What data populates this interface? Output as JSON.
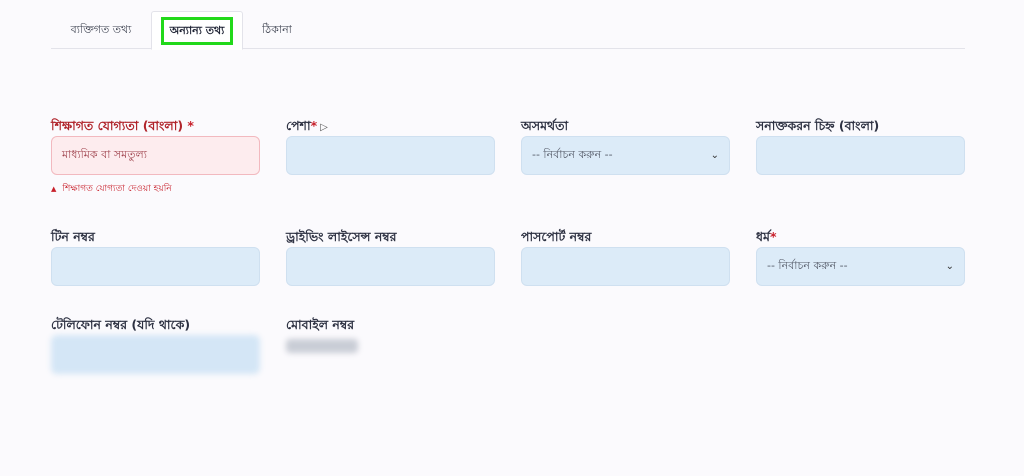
{
  "tabs": [
    {
      "label": "ব্যক্তিগত তথ্য"
    },
    {
      "label": "অন্যান্য তথ্য"
    },
    {
      "label": "ঠিকানা"
    }
  ],
  "fields": {
    "education": {
      "label": "শিক্ষাগত যোগ্যতা (বাংলা)",
      "required": "*",
      "value": "মাধ্যমিক বা সমতুল্য",
      "error": "শিক্ষাগত যোগ্যতা দেওয়া হয়নি"
    },
    "occupation": {
      "label": "পেশা",
      "required": "*"
    },
    "disability": {
      "label": "অসমর্থতা",
      "placeholder": "-- নির্বাচন করুন --"
    },
    "identification_mark": {
      "label": "সনাক্তকরন চিহ্ন (বাংলা)"
    },
    "tin": {
      "label": "টিন নম্বর"
    },
    "driving_license": {
      "label": "ড্রাইভিং লাইসেন্স নম্বর"
    },
    "passport": {
      "label": "পাসপোর্ট নম্বর"
    },
    "religion": {
      "label": "ধর্ম",
      "required": "*",
      "placeholder": "-- নির্বাচন করুন --"
    },
    "telephone": {
      "label": "টেলিফোন নম্বর (যদি থাকে)"
    },
    "mobile": {
      "label": "মোবাইল নম্বর"
    }
  },
  "colors": {
    "active_tab_highlight": "#22d91a",
    "input_bg": "#dcebf8",
    "error_bg": "#fdecee",
    "error_text": "#c8202b"
  },
  "icons": {
    "select_chevron": "chevron-down-icon",
    "error_indicator": "warning-triangle-icon"
  }
}
